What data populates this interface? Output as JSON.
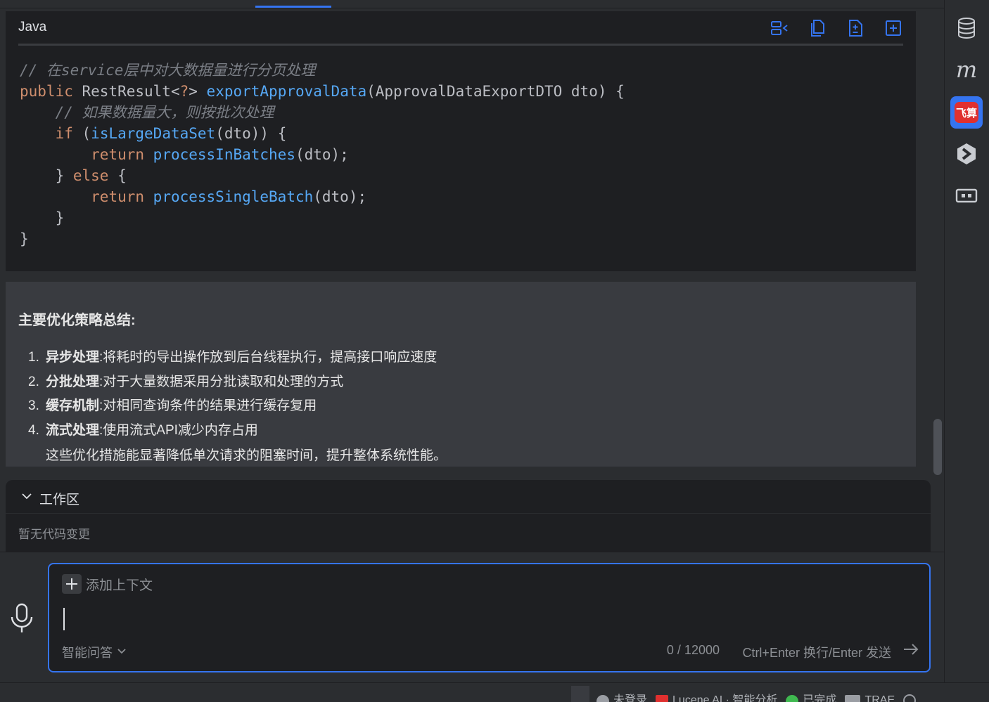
{
  "code_block": {
    "language": "Java",
    "toolbar_icons": [
      "insert-icon",
      "copy-icon",
      "diff-icon",
      "new-file-icon"
    ],
    "lines": [
      [
        {
          "t": "cm",
          "v": "// 在service层中对大数据量进行分页处理"
        }
      ],
      [
        {
          "t": "kw",
          "v": "public "
        },
        {
          "t": "pl",
          "v": "RestResult<"
        },
        {
          "t": "kw",
          "v": "?"
        },
        {
          "t": "pl",
          "v": "> "
        },
        {
          "t": "fn",
          "v": "exportApprovalData"
        },
        {
          "t": "pl",
          "v": "(ApprovalDataExportDTO dto) {"
        }
      ],
      [
        {
          "t": "pl",
          "v": "    "
        },
        {
          "t": "cm",
          "v": "// 如果数据量大，则按批次处理"
        }
      ],
      [
        {
          "t": "pl",
          "v": "    "
        },
        {
          "t": "kw",
          "v": "if "
        },
        {
          "t": "pl",
          "v": "("
        },
        {
          "t": "fn",
          "v": "isLargeDataSet"
        },
        {
          "t": "pl",
          "v": "(dto)) {"
        }
      ],
      [
        {
          "t": "pl",
          "v": "        "
        },
        {
          "t": "kw",
          "v": "return "
        },
        {
          "t": "fn",
          "v": "processInBatches"
        },
        {
          "t": "pl",
          "v": "(dto);"
        }
      ],
      [
        {
          "t": "pl",
          "v": "    } "
        },
        {
          "t": "kw",
          "v": "else "
        },
        {
          "t": "pl",
          "v": "{"
        }
      ],
      [
        {
          "t": "pl",
          "v": "        "
        },
        {
          "t": "kw",
          "v": "return "
        },
        {
          "t": "fn",
          "v": "processSingleBatch"
        },
        {
          "t": "pl",
          "v": "(dto);"
        }
      ],
      [
        {
          "t": "pl",
          "v": "    }"
        }
      ],
      [
        {
          "t": "pl",
          "v": "}"
        }
      ]
    ]
  },
  "summary": {
    "title": "主要优化策略总结:",
    "items": [
      {
        "num": "1.",
        "term": "异步处理",
        "sep": ": ",
        "desc": "将耗时的导出操作放到后台线程执行，提高接口响应速度"
      },
      {
        "num": "2.",
        "term": "分批处理",
        "sep": ": ",
        "desc": "对于大量数据采用分批读取和处理的方式"
      },
      {
        "num": "3.",
        "term": "缓存机制",
        "sep": ": ",
        "desc": "对相同查询条件的结果进行缓存复用"
      },
      {
        "num": "4.",
        "term": "流式处理",
        "sep": ": ",
        "desc": "使用流式API减少内存占用"
      }
    ],
    "footer": "这些优化措施能显著降低单次请求的阻塞时间，提升整体系统性能。"
  },
  "workspace": {
    "title": "工作区",
    "empty_text": "暂无代码变更"
  },
  "input": {
    "add_context_label": "添加上下文",
    "mode_label": "智能问答",
    "counter": "0 / 12000",
    "hint": "Ctrl+Enter 换行/Enter 发送"
  },
  "statusbar": {
    "items": [
      {
        "label": "未登录",
        "icon": "user-icon",
        "color": "#9a9da3"
      },
      {
        "label": "Lucene AI · 智能分析",
        "icon": "ai-icon",
        "color": "#e0302f"
      },
      {
        "label": "已完成",
        "icon": "status-icon",
        "color": "#3fb950"
      },
      {
        "label": "TRAE",
        "icon": "trae-icon",
        "color": "#9a9da3"
      }
    ]
  },
  "rail": {
    "feishu_label": "飞算",
    "m_label": "m"
  },
  "colors": {
    "accent": "#3574f0",
    "keyword": "#cf8e6d",
    "function": "#56a8f5",
    "comment": "#7a7e85"
  }
}
